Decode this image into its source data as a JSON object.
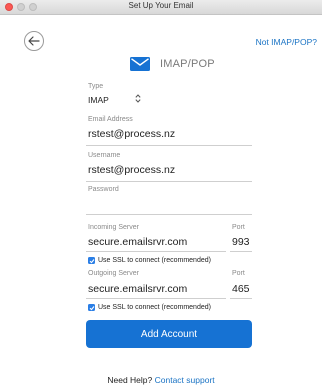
{
  "window": {
    "title": "Set Up Your Email"
  },
  "nav": {
    "not_imap_link": "Not IMAP/POP?"
  },
  "header": {
    "title": "IMAP/POP"
  },
  "form": {
    "type": {
      "label": "Type",
      "value": "IMAP"
    },
    "email": {
      "label": "Email Address",
      "value": "rstest@process.nz"
    },
    "username": {
      "label": "Username",
      "value": "rstest@process.nz"
    },
    "password": {
      "label": "Password",
      "value": ""
    },
    "incoming": {
      "label": "Incoming Server",
      "value": "secure.emailsrvr.com",
      "port_label": "Port",
      "port": "993",
      "ssl_label": "Use SSL to connect (recommended)",
      "ssl_checked": true
    },
    "outgoing": {
      "label": "Outgoing Server",
      "value": "secure.emailsrvr.com",
      "port_label": "Port",
      "port": "465",
      "ssl_label": "Use SSL to connect (recommended)",
      "ssl_checked": true
    }
  },
  "actions": {
    "add_account": "Add Account"
  },
  "help": {
    "prefix": "Need Help?",
    "link": "Contact support"
  },
  "colors": {
    "accent": "#1672d3",
    "link": "#1a73c4",
    "close": "#fc5753"
  },
  "icons": [
    "back-arrow-icon",
    "mail-icon",
    "chevron-updown-icon",
    "checkmark-icon"
  ]
}
